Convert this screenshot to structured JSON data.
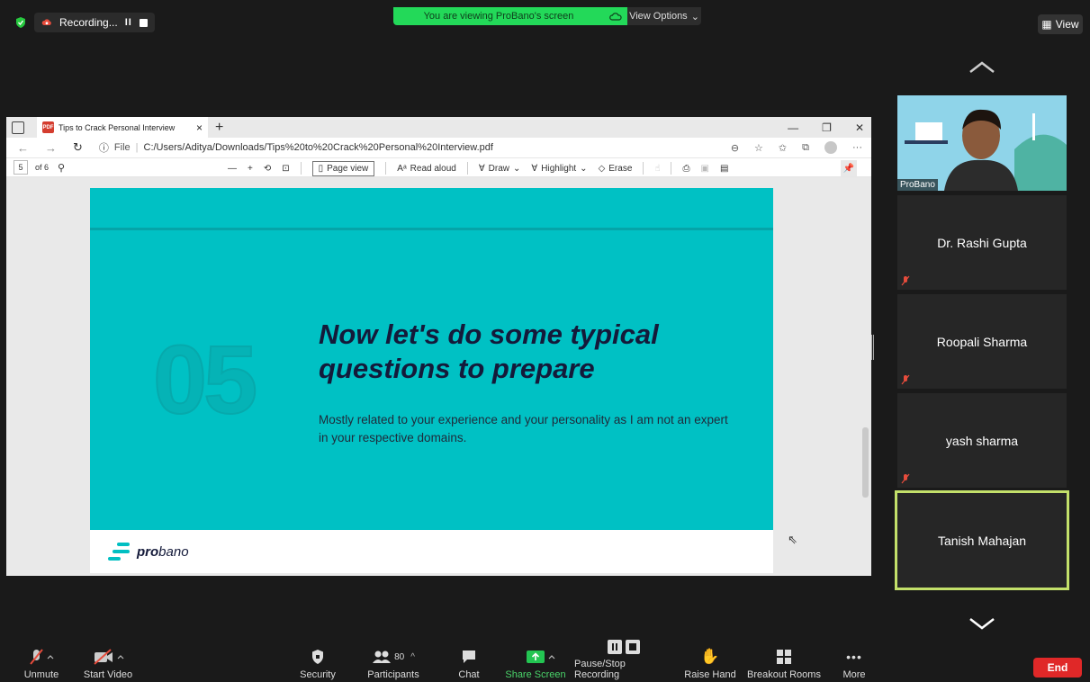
{
  "meeting": {
    "recording_label": "Recording...",
    "recording_pause": "II",
    "viewing_banner": "You are viewing ProBano's screen",
    "view_options": "View Options",
    "view_button": "View",
    "colors": {
      "banner": "#23d959",
      "end": "#e02828",
      "active_border": "#c3e06a"
    }
  },
  "browser": {
    "tab_title": "Tips to Crack Personal Interview",
    "tab_close": "×",
    "tab_plus": "+",
    "win_minimize": "—",
    "win_restore": "❐",
    "win_close": "✕",
    "url_label": "File",
    "url": "C:/Users/Aditya/Downloads/Tips%20to%20Crack%20Personal%20Interview.pdf",
    "more": "···"
  },
  "pdf_toolbar": {
    "page": "5",
    "of": "of 6",
    "minus": "—",
    "plus": "+",
    "page_view": "Page view",
    "read_aloud": "Read aloud",
    "draw": "Draw",
    "highlight": "Highlight",
    "erase": "Erase"
  },
  "slide": {
    "number": "05",
    "title": "Now let's do some typical questions to prepare",
    "body": "Mostly related to your experience and your personality as I am not an expert in your respective domains.",
    "logo_text_bold": "pro",
    "logo_text_rest": "bano"
  },
  "participants": [
    {
      "name": "ProBano"
    },
    {
      "name": "Dr. Rashi Gupta"
    },
    {
      "name": "Roopali Sharma"
    },
    {
      "name": "yash sharma"
    },
    {
      "name": "Tanish Mahajan"
    }
  ],
  "toolbar": {
    "unmute": "Unmute",
    "start_video": "Start Video",
    "security": "Security",
    "participants": "Participants",
    "participant_count": "80",
    "chat": "Chat",
    "share_screen": "Share Screen",
    "pause_stop_recording": "Pause/Stop Recording",
    "raise_hand": "Raise Hand",
    "breakout_rooms": "Breakout Rooms",
    "more": "More",
    "end": "End"
  }
}
